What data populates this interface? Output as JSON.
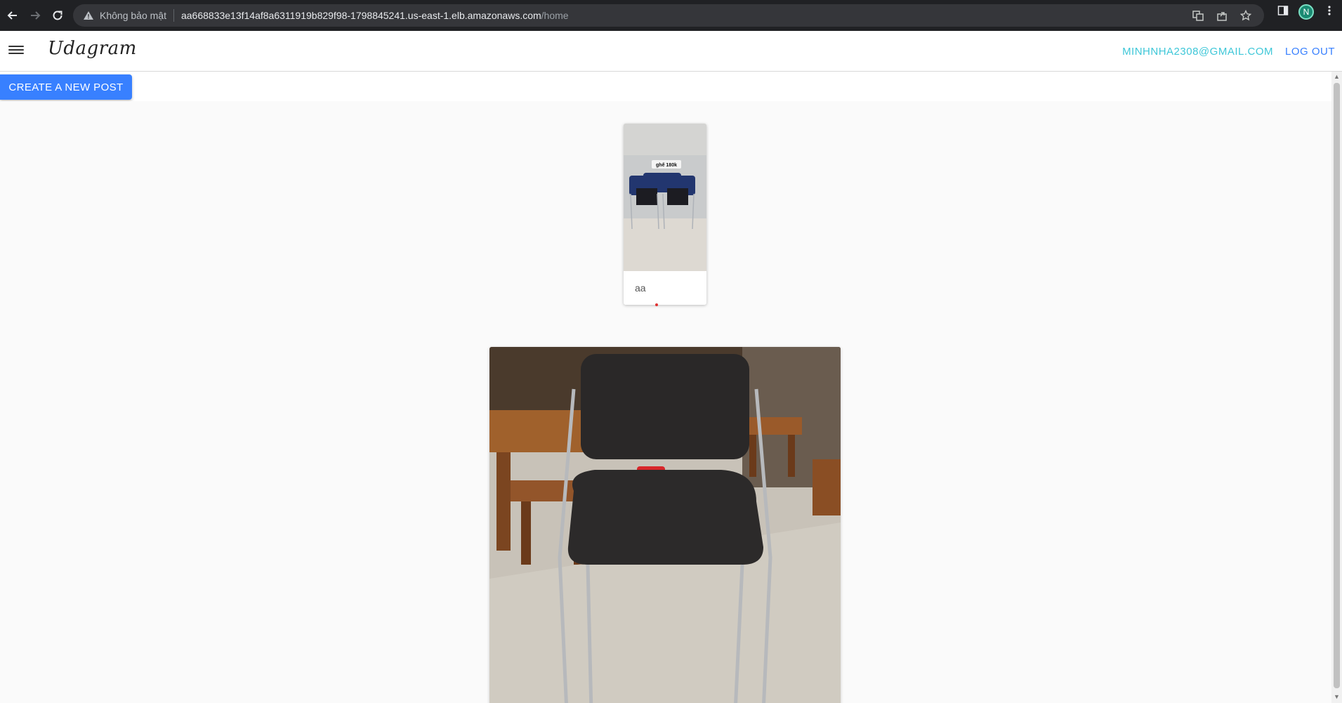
{
  "browser": {
    "security_label": "Không bảo mật",
    "url_host": "aa668833e13f14af8a6311919b829f98-1798845241.us-east-1.elb.amazonaws.com",
    "url_path": "/home",
    "profile_initial": "N"
  },
  "app": {
    "brand": "Udagram",
    "user_email": "MINHNHA2308@GMAIL.COM",
    "logout_label": "LOG OUT",
    "create_post_label": "CREATE A NEW POST"
  },
  "feed": {
    "items": [
      {
        "caption": "aa",
        "image_sign_text": "ghế 180k"
      },
      {
        "caption": ""
      }
    ]
  },
  "colors": {
    "accent": "#3880ff",
    "email": "#3ec7d8",
    "chrome_bg": "#202124"
  }
}
